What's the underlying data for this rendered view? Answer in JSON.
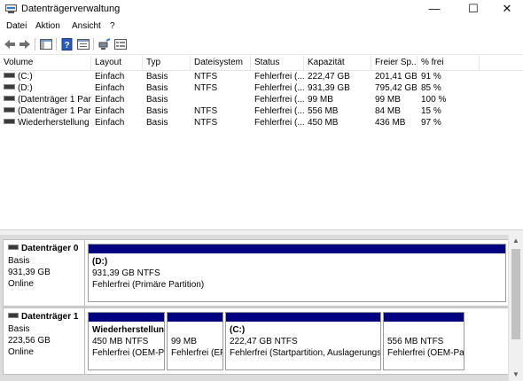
{
  "window": {
    "title": "Datenträgerverwaltung",
    "minimize": "—",
    "maximize": "☐",
    "close": "✕"
  },
  "menu": {
    "items": [
      "Datei",
      "Aktion",
      "Ansicht",
      "?"
    ]
  },
  "toolbar": {
    "icons": [
      "back-arrow-icon",
      "forward-arrow-icon",
      "console-tree-icon",
      "help-icon",
      "properties-icon",
      "connect-icon",
      "settings-icon"
    ]
  },
  "volumes": {
    "columns": [
      "Volume",
      "Layout",
      "Typ",
      "Dateisystem",
      "Status",
      "Kapazität",
      "Freier Sp...",
      "% frei"
    ],
    "rows": [
      [
        "(C:)",
        "Einfach",
        "Basis",
        "NTFS",
        "Fehlerfrei (...",
        "222,47 GB",
        "201,41 GB",
        "91 %"
      ],
      [
        "(D:)",
        "Einfach",
        "Basis",
        "NTFS",
        "Fehlerfrei (...",
        "931,39 GB",
        "795,42 GB",
        "85 %"
      ],
      [
        "(Datenträger 1 Par...",
        "Einfach",
        "Basis",
        "",
        "Fehlerfrei (...",
        "99 MB",
        "99 MB",
        "100 %"
      ],
      [
        "(Datenträger 1 Par...",
        "Einfach",
        "Basis",
        "NTFS",
        "Fehlerfrei (...",
        "556 MB",
        "84 MB",
        "15 %"
      ],
      [
        "Wiederherstellung",
        "Einfach",
        "Basis",
        "NTFS",
        "Fehlerfrei (...",
        "450 MB",
        "436 MB",
        "97 %"
      ]
    ]
  },
  "disks": [
    {
      "name": "Datenträger 0",
      "type": "Basis",
      "size": "931,39 GB",
      "state": "Online",
      "partitions": [
        {
          "title": "(D:)",
          "size_fs": "931,39 GB NTFS",
          "status": "Fehlerfrei (Primäre Partition)"
        }
      ]
    },
    {
      "name": "Datenträger 1",
      "type": "Basis",
      "size": "223,56 GB",
      "state": "Online",
      "partitions": [
        {
          "title": "Wiederherstellun",
          "size_fs": "450 MB NTFS",
          "status": "Fehlerfrei (OEM-Pa"
        },
        {
          "title": "",
          "size_fs": "99 MB",
          "status": "Fehlerfrei (EF"
        },
        {
          "title": "(C:)",
          "size_fs": "222,47 GB NTFS",
          "status": "Fehlerfrei (Startpartition, Auslagerungsd"
        },
        {
          "title": "",
          "size_fs": "556 MB NTFS",
          "status": "Fehlerfrei (OEM-Par"
        }
      ]
    }
  ],
  "colors": {
    "partition_header": "#000080",
    "graph_background": "#dcdcdc"
  }
}
